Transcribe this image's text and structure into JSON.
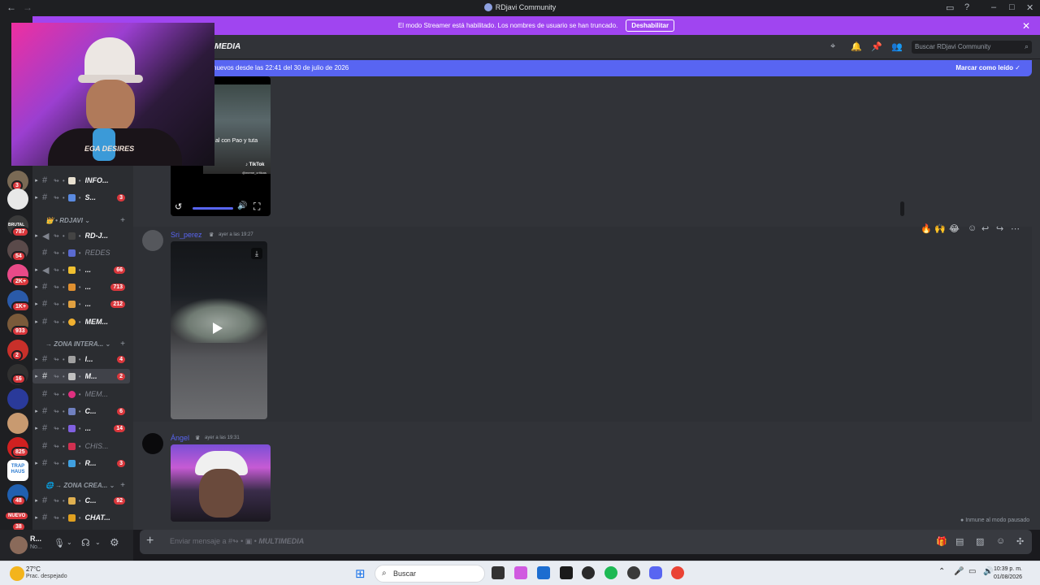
{
  "window": {
    "title": "RDjavi Community"
  },
  "streamer_mode": {
    "message": "El modo Streamer está habilitado. Los nombres de usuario se han truncado.",
    "button": "Deshabilitar"
  },
  "header": {
    "channel_name": "MEDIA",
    "search_placeholder": "Buscar RDjavi Community"
  },
  "new_messages": {
    "text": "nuevos desde las 22:41 del 30 de julio de 2026",
    "mark_read": "Marcar como leído"
  },
  "guilds": {
    "badges": [
      "3",
      "787",
      "54",
      "2K+",
      "1K+",
      "933",
      "2",
      "16",
      "825",
      "48",
      "38"
    ],
    "new_label": "NUEVO",
    "labels": {
      "brutal": "BRUTAL",
      "trap_haus": "TRAP HAUS"
    }
  },
  "channels": [
    {
      "name": "INFO...",
      "badge": ""
    },
    {
      "name": "S...",
      "badge": "3"
    },
    {
      "category": "RDJAVI"
    },
    {
      "name": "RD-J...",
      "badge": ""
    },
    {
      "name": "REDES",
      "badge": "",
      "muted": true
    },
    {
      "name": "...",
      "badge": "66"
    },
    {
      "name": "...",
      "badge": "713"
    },
    {
      "name": "...",
      "badge": "212"
    },
    {
      "name": "MEM...",
      "badge": ""
    },
    {
      "category": "ZONA INTERA..."
    },
    {
      "name": "I...",
      "badge": "4"
    },
    {
      "name": "M...",
      "badge": "2",
      "selected": true
    },
    {
      "name": "MEM...",
      "badge": "",
      "muted": true
    },
    {
      "name": "C...",
      "badge": "6"
    },
    {
      "name": "...",
      "badge": "14"
    },
    {
      "name": "CHIS...",
      "badge": "",
      "muted": true
    },
    {
      "name": "R...",
      "badge": "3"
    },
    {
      "category": "ZONA CREA..."
    },
    {
      "name": "C...",
      "badge": "92"
    },
    {
      "name": "CHAT...",
      "badge": ""
    }
  ],
  "user_panel": {
    "name": "R...",
    "status": "No..."
  },
  "tiktok_embed": {
    "caption": "al con Pao y tuta",
    "brand": "TikTok",
    "handle": "@meme_criticas"
  },
  "messages": [
    {
      "author": "Sri_perez",
      "timestamp": "ayer a las 19:27"
    },
    {
      "author": "Ángel",
      "timestamp": "ayer a las 19:31"
    }
  ],
  "immune_note": "Inmune al modo pausado",
  "composer": {
    "placeholder_prefix": "Enviar mensaje a #",
    "placeholder_channel": "MULTIMEDIA"
  },
  "stream_overlay": {
    "shirt_text": "EGA DESIRES"
  },
  "taskbar": {
    "temperature": "27°C",
    "condition": "Prac. despejado",
    "search": "Buscar",
    "time": "10:39 p. m.",
    "date": "01/08/2026"
  },
  "colors": {
    "accent": "#5865f2",
    "streamer": "#a045f0",
    "badge": "#da373c"
  }
}
